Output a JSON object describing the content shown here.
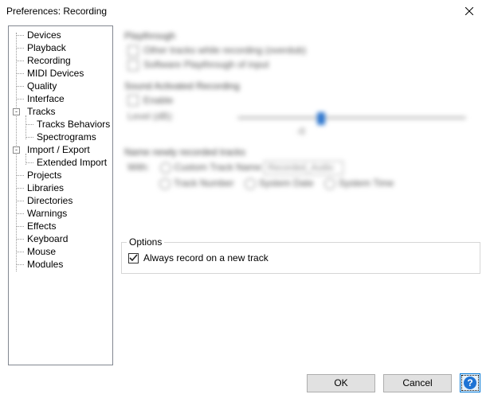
{
  "window": {
    "title": "Preferences: Recording"
  },
  "tree": {
    "items": [
      {
        "label": "Devices"
      },
      {
        "label": "Playback"
      },
      {
        "label": "Recording"
      },
      {
        "label": "MIDI Devices"
      },
      {
        "label": "Quality"
      },
      {
        "label": "Interface"
      },
      {
        "label": "Tracks",
        "expander": "-",
        "children": [
          {
            "label": "Tracks Behaviors"
          },
          {
            "label": "Spectrograms"
          }
        ]
      },
      {
        "label": "Import / Export",
        "expander": "-",
        "children": [
          {
            "label": "Extended Import"
          }
        ]
      },
      {
        "label": "Projects"
      },
      {
        "label": "Libraries"
      },
      {
        "label": "Directories"
      },
      {
        "label": "Warnings"
      },
      {
        "label": "Effects"
      },
      {
        "label": "Keyboard"
      },
      {
        "label": "Mouse"
      },
      {
        "label": "Modules"
      }
    ]
  },
  "panel": {
    "options_title": "Options",
    "always_record_label": "Always record on a new track",
    "always_record_checked": true
  },
  "buttons": {
    "ok": "OK",
    "cancel": "Cancel",
    "help": "?"
  },
  "blurred": {
    "g1_title": "Playthrough",
    "g1_l1": "Other tracks while recording (overdub)",
    "g1_l2": "Software Playthrough of input",
    "g2_title": "Sound Activated Recording",
    "g2_l1": "Enable",
    "g2_level": "Level (dB):",
    "g3_title": "Name newly recorded tracks",
    "g3_with": "With:",
    "g3_custom": "Custom Track Name",
    "g3_custom_val": "Recorded_Audio",
    "g3_tracknum": "Track Number",
    "g3_sysdate": "System Date",
    "g3_systime": "System Time"
  }
}
